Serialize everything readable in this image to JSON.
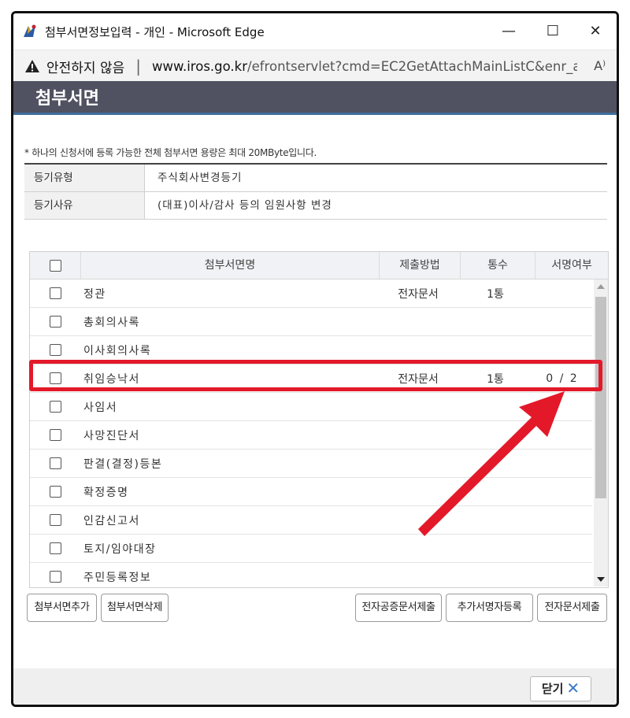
{
  "window": {
    "title": "첨부서면정보입력 - 개인 - Microsoft Edge",
    "minimize": "—",
    "maximize": "☐",
    "close": "✕"
  },
  "address": {
    "warning": "안전하지 않음",
    "separator": "|",
    "domain": "www.iros.go.kr",
    "path": "/efrontservlet?cmd=EC2GetAttachMainListC&enr_a...",
    "read_aloud": "A⁾"
  },
  "page": {
    "title": "첨부서면",
    "notice": "* 하나의 신청서에 등록 가능한 전체 첨부서면 용량은 최대 20MByte입니다."
  },
  "info": [
    {
      "label": "등기유형",
      "value": "주식회사변경등기"
    },
    {
      "label": "등기사유",
      "value": "(대표)이사/감사 등의 임원사항 변경"
    }
  ],
  "table": {
    "headers": {
      "name": "첨부서면명",
      "method": "제출방법",
      "count": "통수",
      "sign": "서명여부"
    },
    "rows": [
      {
        "name": "정관",
        "method": "전자문서",
        "count": "1통",
        "sign": ""
      },
      {
        "name": "총회의사록",
        "method": "",
        "count": "",
        "sign": ""
      },
      {
        "name": "이사회의사록",
        "method": "",
        "count": "",
        "sign": ""
      },
      {
        "name": "취임승낙서",
        "method": "전자문서",
        "count": "1통",
        "sign": "0 / 2"
      },
      {
        "name": "사임서",
        "method": "",
        "count": "",
        "sign": ""
      },
      {
        "name": "사망진단서",
        "method": "",
        "count": "",
        "sign": ""
      },
      {
        "name": "판결(결정)등본",
        "method": "",
        "count": "",
        "sign": ""
      },
      {
        "name": "확정증명",
        "method": "",
        "count": "",
        "sign": ""
      },
      {
        "name": "인감신고서",
        "method": "",
        "count": "",
        "sign": ""
      },
      {
        "name": "토지/임야대장",
        "method": "",
        "count": "",
        "sign": ""
      },
      {
        "name": "주민등록정보",
        "method": "",
        "count": "",
        "sign": ""
      }
    ]
  },
  "buttons": {
    "add": "첨부서면추가",
    "delete": "첨부서면삭제",
    "notarized": "전자공증문서제출",
    "add_signer": "추가서명자등록",
    "submit": "전자문서제출",
    "close": "닫기"
  },
  "colors": {
    "header_bg": "#505262",
    "highlight": "#e3192a",
    "accent_line": "#3f6f9e"
  }
}
